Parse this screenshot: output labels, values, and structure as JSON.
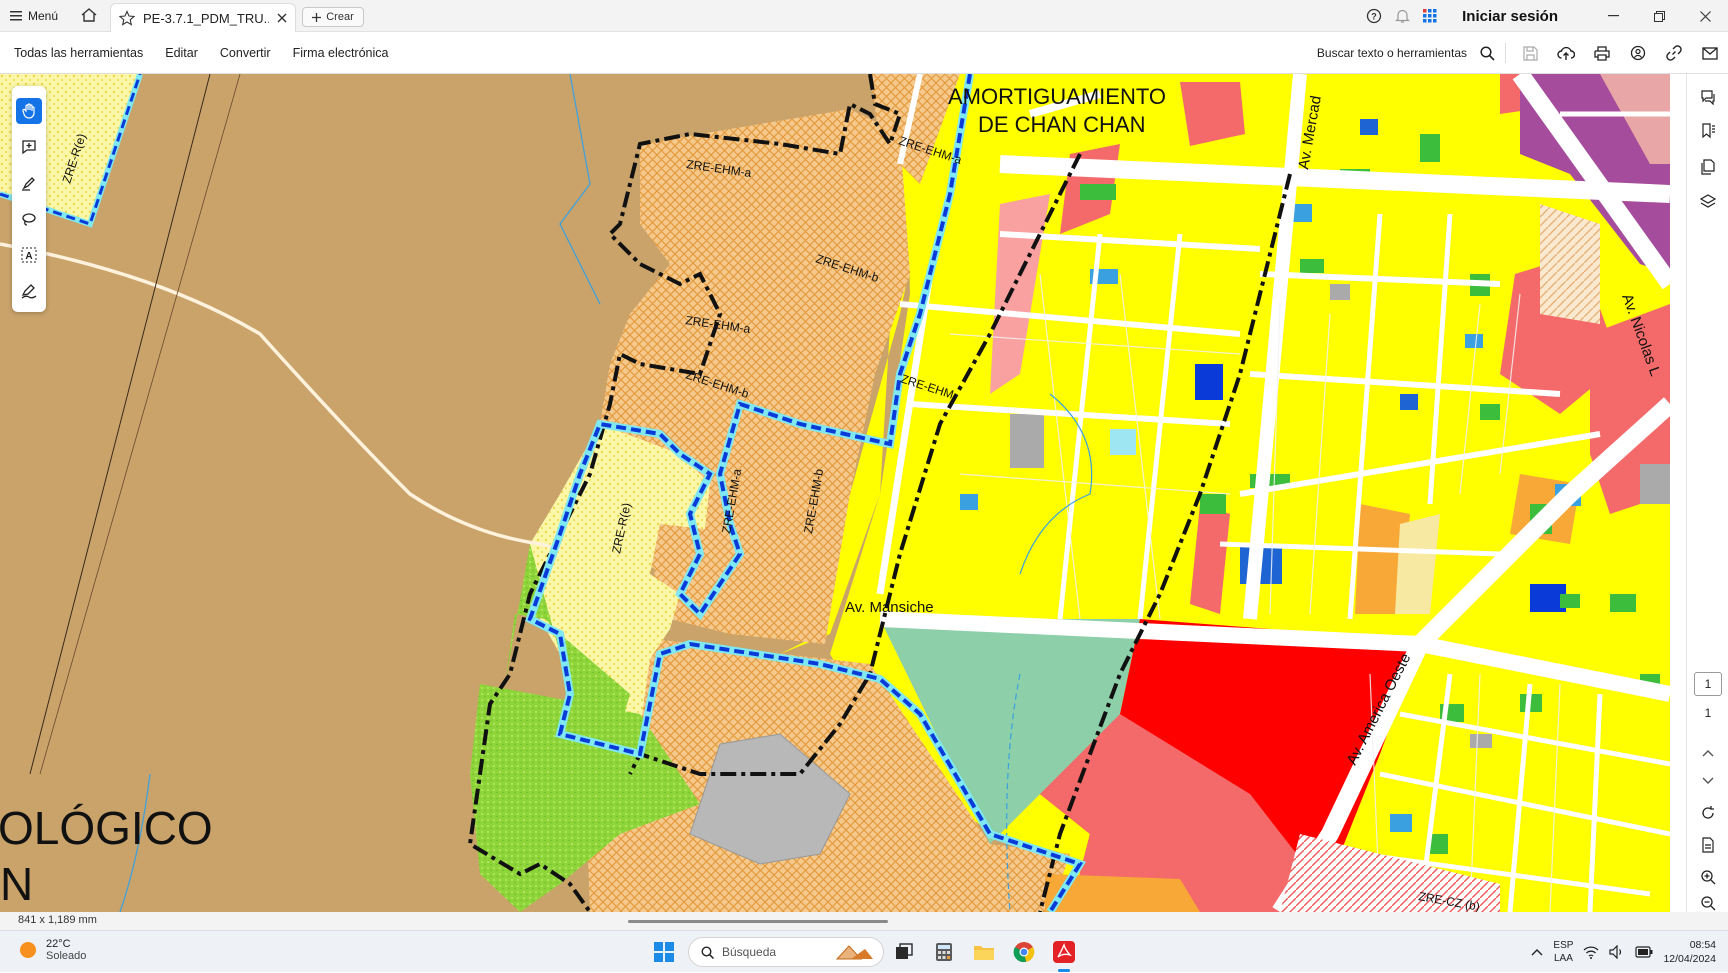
{
  "titlebar": {
    "menu_label": "Menú",
    "tab_title": "PE-3.7.1_PDM_TRU...",
    "new_tab_label": "Crear",
    "signin_label": "Iniciar sesión"
  },
  "toolbar": {
    "items": [
      "Todas las herramientas",
      "Editar",
      "Convertir",
      "Firma electrónica"
    ],
    "search_label": "Buscar texto o herramientas"
  },
  "map_labels": {
    "amortiguamiento_1": "AMORTIGUAMIENTO",
    "amortiguamiento_2": "DE CHAN CHAN",
    "zre_ehm_a": "ZRE-EHM-a",
    "zre_ehm_b": "ZRE-EHM-b",
    "zre_ehm_short": "ZRE-EHM-",
    "zre_r_e": "ZRE-R(e)",
    "zre_cz_b": "ZRE-CZ (b)",
    "av_mansiche": "Av. Mansiche",
    "av_mercado": "Av. Mercad",
    "av_nicolas": "Av. Nicolas L",
    "av_america": "Av. America Oeste",
    "arqueologico": "OLÓGICO",
    "n_letter": "N"
  },
  "status": {
    "page_dimensions": "841 x 1,189 mm",
    "current_page": "1",
    "total_pages": "1"
  },
  "taskbar": {
    "temperature": "22°C",
    "weather": "Soleado",
    "search_placeholder": "Búsqueda",
    "lang_1": "ESP",
    "lang_2": "LAA",
    "time": "08:54",
    "date": "12/04/2024"
  },
  "colors": {
    "accent": "#1473e6",
    "acrobat_red": "#e42127",
    "map_tan": "#c9a36a",
    "map_yellow": "#ffff00",
    "map_red": "#ff0000",
    "map_pink": "#f46a6a",
    "map_green": "#8ed53a",
    "map_teal": "#8ccfa8",
    "map_purple": "#a64c9c",
    "boundary_blue": "#0a3ad8",
    "boundary_cyan": "#7fe8f0"
  }
}
